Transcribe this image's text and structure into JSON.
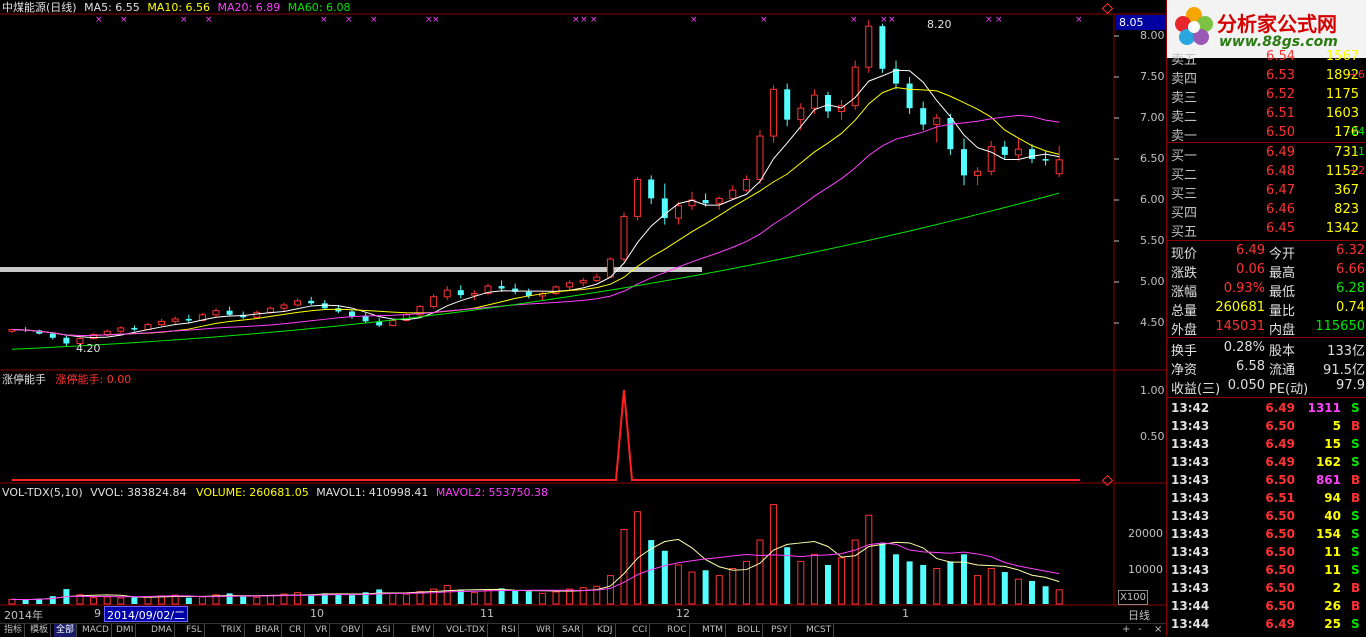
{
  "header": {
    "title": "中煤能源(日线)",
    "ma5": "MA5: 6.55",
    "ma10": "MA10: 6.56",
    "ma20": "MA20: 6.89",
    "ma60": "MA60: 6.08"
  },
  "main_chart": {
    "y_ticks": [
      "8.00",
      "7.50",
      "7.00",
      "6.50",
      "6.00",
      "5.50",
      "5.00",
      "4.50"
    ],
    "current_price_box": "8.05",
    "high_annotation": "8.20",
    "low_annotation": "4.20"
  },
  "indicator1": {
    "name": "涨停能手",
    "value_label": "涨停能手: 0.00",
    "y_ticks": [
      "1.00",
      "0.50"
    ]
  },
  "indicator2": {
    "name": "VOL-TDX(5,10)",
    "vvol": "VVOL: 383824.84",
    "volume": "VOLUME: 260681.05",
    "mavol1": "MAVOL1: 410998.41",
    "mavol2": "MAVOL2: 553750.38",
    "y_ticks": [
      "20000",
      "10000"
    ],
    "unit": "X100"
  },
  "x_axis": {
    "months": [
      "2014年",
      "9",
      "10",
      "11",
      "12",
      "1"
    ],
    "cursor_date": "2014/09/02/二",
    "period": "日线"
  },
  "order_book": {
    "asks": [
      {
        "label": "卖五",
        "price": "6.54",
        "vol": "1567",
        "chg": ""
      },
      {
        "label": "卖四",
        "price": "6.53",
        "vol": "1892",
        "chg": "+6"
      },
      {
        "label": "卖三",
        "price": "6.52",
        "vol": "1175",
        "chg": ""
      },
      {
        "label": "卖二",
        "price": "6.51",
        "vol": "1603",
        "chg": ""
      },
      {
        "label": "卖一",
        "price": "6.50",
        "vol": "176",
        "chg": "-24"
      }
    ],
    "bids": [
      {
        "label": "买一",
        "price": "6.49",
        "vol": "731",
        "chg": "-1"
      },
      {
        "label": "买二",
        "price": "6.48",
        "vol": "1152",
        "chg": "+2"
      },
      {
        "label": "买三",
        "price": "6.47",
        "vol": "367",
        "chg": ""
      },
      {
        "label": "买四",
        "price": "6.46",
        "vol": "823",
        "chg": ""
      },
      {
        "label": "买五",
        "price": "6.45",
        "vol": "1342",
        "chg": ""
      }
    ]
  },
  "stats": {
    "xianjia_l": "现价",
    "xianjia": "6.49",
    "jinkai_l": "今开",
    "jinkai": "6.32",
    "zhangdie_l": "涨跌",
    "zhangdie": "0.06",
    "zuigao_l": "最高",
    "zuigao": "6.66",
    "zhangfu_l": "涨幅",
    "zhangfu": "0.93%",
    "zuidi_l": "最低",
    "zuidi": "6.28",
    "zongliang_l": "总量",
    "zongliang": "260681",
    "liangbi_l": "量比",
    "liangbi": "0.74",
    "waipan_l": "外盘",
    "waipan": "145031",
    "neipan_l": "内盘",
    "neipan": "115650",
    "huanshou_l": "换手",
    "huanshou": "0.28%",
    "guben_l": "股本",
    "guben": "133亿",
    "jingzi_l": "净资",
    "jingzi": "6.58",
    "liutong_l": "流通",
    "liutong": "91.5亿",
    "shouyi_l": "收益(三)",
    "shouyi": "0.050",
    "pe_l": "PE(动)",
    "pe": "97.9"
  },
  "ticks": [
    {
      "time": "13:42",
      "price": "6.49",
      "vol": "1311",
      "side": "S"
    },
    {
      "time": "13:43",
      "price": "6.50",
      "vol": "5",
      "side": "B"
    },
    {
      "time": "13:43",
      "price": "6.49",
      "vol": "15",
      "side": "S"
    },
    {
      "time": "13:43",
      "price": "6.49",
      "vol": "162",
      "side": "S"
    },
    {
      "time": "13:43",
      "price": "6.50",
      "vol": "861",
      "side": "B"
    },
    {
      "time": "13:43",
      "price": "6.51",
      "vol": "94",
      "side": "B"
    },
    {
      "time": "13:43",
      "price": "6.50",
      "vol": "40",
      "side": "S"
    },
    {
      "time": "13:43",
      "price": "6.50",
      "vol": "154",
      "side": "S"
    },
    {
      "time": "13:43",
      "price": "6.50",
      "vol": "11",
      "side": "S"
    },
    {
      "time": "13:43",
      "price": "6.50",
      "vol": "11",
      "side": "S"
    },
    {
      "time": "13:43",
      "price": "6.50",
      "vol": "2",
      "side": "B"
    },
    {
      "time": "13:44",
      "price": "6.50",
      "vol": "26",
      "side": "B"
    },
    {
      "time": "13:44",
      "price": "6.49",
      "vol": "25",
      "side": "S"
    }
  ],
  "logo": {
    "title": "分析家公式网",
    "url": "www.88gs.com"
  },
  "tabs": [
    "指标",
    "模板",
    "全部",
    "MACD",
    "DMI",
    "DMA",
    "FSL",
    "TRIX",
    "BRAR",
    "CR",
    "VR",
    "OBV",
    "ASI",
    "EMV",
    "VOL-TDX",
    "RSI",
    "WR",
    "SAR",
    "KDJ",
    "CCI",
    "ROC",
    "MTM",
    "BOLL",
    "PSY",
    "MCST"
  ],
  "corner_controls": [
    "+",
    "-",
    "×"
  ],
  "colors": {
    "up": "#ff3232",
    "down": "#54ffff",
    "ma5": "#ffffff",
    "ma10": "#ffff00",
    "ma20": "#ff40ff",
    "ma60": "#00e600",
    "grid": "#8b0000"
  },
  "candle_data": [
    [
      4.4,
      4.43,
      4.38,
      4.42
    ],
    [
      4.42,
      4.45,
      4.39,
      4.41
    ],
    [
      4.41,
      4.42,
      4.36,
      4.37
    ],
    [
      4.37,
      4.39,
      4.3,
      4.32
    ],
    [
      4.32,
      4.35,
      4.22,
      4.25
    ],
    [
      4.25,
      4.33,
      4.24,
      4.31
    ],
    [
      4.31,
      4.38,
      4.3,
      4.36
    ],
    [
      4.36,
      4.42,
      4.34,
      4.4
    ],
    [
      4.4,
      4.46,
      4.38,
      4.44
    ],
    [
      4.44,
      4.47,
      4.4,
      4.42
    ],
    [
      4.42,
      4.5,
      4.41,
      4.48
    ],
    [
      4.48,
      4.55,
      4.46,
      4.52
    ],
    [
      4.52,
      4.58,
      4.49,
      4.55
    ],
    [
      4.55,
      4.6,
      4.5,
      4.53
    ],
    [
      4.53,
      4.62,
      4.52,
      4.6
    ],
    [
      4.6,
      4.68,
      4.58,
      4.65
    ],
    [
      4.65,
      4.7,
      4.58,
      4.6
    ],
    [
      4.6,
      4.64,
      4.55,
      4.57
    ],
    [
      4.57,
      4.65,
      4.56,
      4.63
    ],
    [
      4.63,
      4.7,
      4.61,
      4.68
    ],
    [
      4.68,
      4.75,
      4.64,
      4.72
    ],
    [
      4.72,
      4.8,
      4.7,
      4.77
    ],
    [
      4.77,
      4.82,
      4.72,
      4.74
    ],
    [
      4.74,
      4.78,
      4.66,
      4.68
    ],
    [
      4.68,
      4.72,
      4.62,
      4.64
    ],
    [
      4.64,
      4.66,
      4.55,
      4.58
    ],
    [
      4.58,
      4.62,
      4.5,
      4.52
    ],
    [
      4.52,
      4.56,
      4.45,
      4.47
    ],
    [
      4.47,
      4.55,
      4.46,
      4.53
    ],
    [
      4.53,
      4.62,
      4.52,
      4.6
    ],
    [
      4.6,
      4.72,
      4.58,
      4.7
    ],
    [
      4.7,
      4.85,
      4.68,
      4.82
    ],
    [
      4.82,
      4.95,
      4.78,
      4.9
    ],
    [
      4.9,
      4.96,
      4.8,
      4.84
    ],
    [
      4.84,
      4.9,
      4.78,
      4.86
    ],
    [
      4.86,
      4.98,
      4.84,
      4.95
    ],
    [
      4.95,
      5.02,
      4.88,
      4.92
    ],
    [
      4.92,
      4.98,
      4.85,
      4.88
    ],
    [
      4.88,
      4.92,
      4.8,
      4.83
    ],
    [
      4.83,
      4.88,
      4.78,
      4.86
    ],
    [
      4.86,
      4.96,
      4.84,
      4.94
    ],
    [
      4.94,
      5.02,
      4.9,
      4.99
    ],
    [
      4.99,
      5.05,
      4.95,
      5.02
    ],
    [
      5.02,
      5.1,
      5.0,
      5.06
    ],
    [
      5.06,
      5.3,
      5.05,
      5.28
    ],
    [
      5.28,
      5.85,
      5.25,
      5.8
    ],
    [
      5.8,
      6.28,
      5.75,
      6.25
    ],
    [
      6.25,
      6.3,
      5.95,
      6.02
    ],
    [
      6.02,
      6.2,
      5.7,
      5.78
    ],
    [
      5.78,
      5.98,
      5.7,
      5.93
    ],
    [
      5.93,
      6.1,
      5.88,
      6.0
    ],
    [
      6.0,
      6.08,
      5.92,
      5.96
    ],
    [
      5.96,
      6.04,
      5.88,
      6.02
    ],
    [
      6.02,
      6.18,
      6.0,
      6.12
    ],
    [
      6.12,
      6.3,
      6.1,
      6.25
    ],
    [
      6.25,
      6.85,
      6.2,
      6.78
    ],
    [
      6.78,
      7.4,
      6.7,
      7.35
    ],
    [
      7.35,
      7.42,
      6.9,
      6.98
    ],
    [
      6.98,
      7.18,
      6.85,
      7.12
    ],
    [
      7.12,
      7.35,
      7.05,
      7.28
    ],
    [
      7.28,
      7.32,
      7.0,
      7.08
    ],
    [
      7.08,
      7.22,
      6.98,
      7.15
    ],
    [
      7.15,
      7.7,
      7.1,
      7.62
    ],
    [
      7.62,
      8.2,
      7.55,
      8.12
    ],
    [
      8.12,
      8.15,
      7.55,
      7.6
    ],
    [
      7.6,
      7.7,
      7.35,
      7.42
    ],
    [
      7.42,
      7.5,
      7.05,
      7.12
    ],
    [
      7.12,
      7.2,
      6.85,
      6.92
    ],
    [
      6.92,
      7.05,
      6.7,
      7.0
    ],
    [
      7.0,
      7.05,
      6.55,
      6.62
    ],
    [
      6.62,
      6.75,
      6.18,
      6.3
    ],
    [
      6.3,
      6.4,
      6.18,
      6.35
    ],
    [
      6.35,
      6.72,
      6.3,
      6.65
    ],
    [
      6.65,
      6.72,
      6.5,
      6.55
    ],
    [
      6.55,
      6.75,
      6.48,
      6.62
    ],
    [
      6.62,
      6.68,
      6.45,
      6.5
    ],
    [
      6.5,
      6.6,
      6.42,
      6.48
    ],
    [
      6.32,
      6.66,
      6.28,
      6.49
    ]
  ],
  "volume_data": [
    1300,
    1200,
    1500,
    2200,
    4200,
    2600,
    1800,
    2000,
    1700,
    1900,
    2100,
    2300,
    2500,
    1800,
    2000,
    2600,
    3000,
    2200,
    1900,
    2400,
    2800,
    3200,
    2700,
    3000,
    2600,
    2500,
    3300,
    4100,
    3000,
    2800,
    3500,
    4200,
    5200,
    4000,
    3200,
    3800,
    4400,
    3900,
    3600,
    3000,
    3400,
    4200,
    4600,
    5000,
    8000,
    21000,
    26000,
    18000,
    15000,
    11000,
    9000,
    9500,
    8000,
    10000,
    12000,
    18000,
    28000,
    16000,
    12000,
    14000,
    11000,
    13000,
    18000,
    25000,
    17000,
    14000,
    12000,
    11000,
    10000,
    12000,
    14000,
    8000,
    10000,
    9000,
    7000,
    6500,
    5000,
    4000
  ],
  "limit_up_index": 45
}
